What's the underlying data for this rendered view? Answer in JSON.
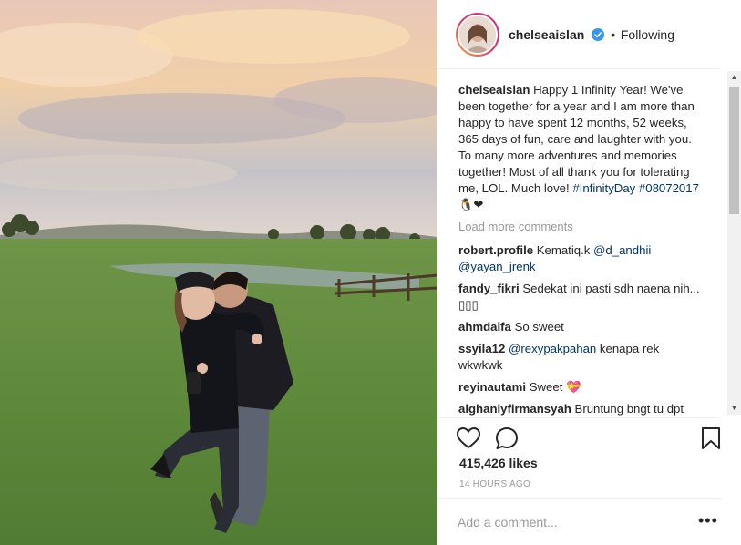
{
  "post": {
    "username": "chelseaislan",
    "separator": "•",
    "follow_status": "Following",
    "caption_text": "Happy 1 Infinity Year! We've been together for a year and I am more than happy to have spent 12 months, 52 weeks, 365 days of fun, care and laughter with you. To many more adventures and memories together! Most of all thank you for tolerating me, LOL. Much love!",
    "caption_tags": "#InfinityDay #08072017",
    "caption_emoji": "🐧❤",
    "load_more": "Load more comments",
    "likes": "415,426 likes",
    "time_ago": "14 HOURS AGO",
    "comment_placeholder": "Add a comment...",
    "more_label": "•••"
  },
  "comments": [
    {
      "user": "robert.profile",
      "text": "Kematiq.k",
      "mention1": "@d_andhii",
      "mention2": "@yayan_jrenk"
    },
    {
      "user": "fandy_fikri",
      "text": "Sedekat ini pasti sdh naena nih... ▯▯▯"
    },
    {
      "user": "ahmdalfa",
      "text": "So sweet"
    },
    {
      "user": "ssyila12",
      "mention": "@rexypakpahan",
      "text": "kenapa rek wkwkwk"
    },
    {
      "user": "reyinautami",
      "text": "Sweet 💝"
    },
    {
      "user": "alghaniyfirmansyah",
      "text": "Bruntung bngt tu dpt"
    }
  ],
  "colors": {
    "link": "#003569",
    "muted": "#999999",
    "verified": "#3897f0",
    "border": "#efefef"
  },
  "icons": [
    "verified-badge-icon",
    "heart-icon",
    "comment-icon",
    "bookmark-icon",
    "more-options-icon"
  ]
}
